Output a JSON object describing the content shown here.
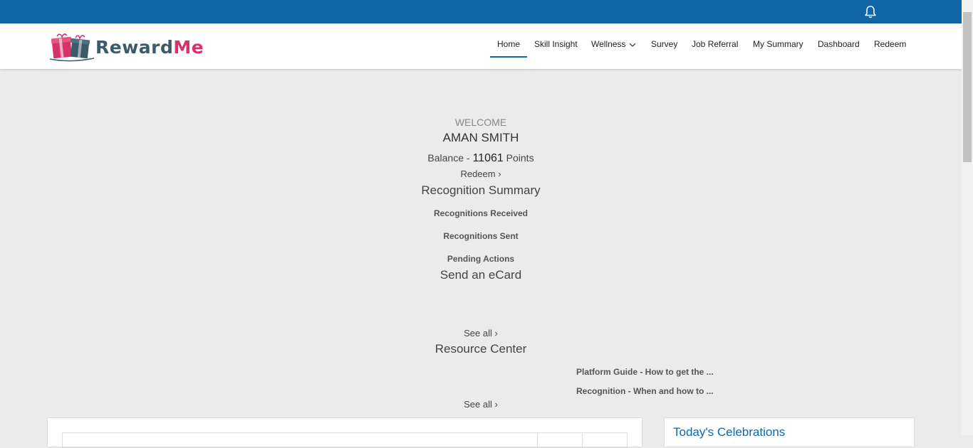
{
  "brand": {
    "part1": "Reward",
    "part2": "Me"
  },
  "nav": {
    "items": [
      "Home",
      "Skill Insight",
      "Wellness",
      "Survey",
      "Job Referral",
      "My Summary",
      "Dashboard",
      "Redeem"
    ]
  },
  "welcome": {
    "label": "WELCOME",
    "name": "AMAN SMITH",
    "balance_prefix": "Balance - ",
    "balance_value": "11061",
    "balance_suffix": " Points",
    "redeem_link": "Redeem ›"
  },
  "recognition": {
    "title": "Recognition Summary",
    "received": "Recognitions Received",
    "sent": "Recognitions Sent",
    "pending": "Pending Actions"
  },
  "ecard": {
    "title": "Send an eCard",
    "see_all": "See all ›"
  },
  "resources": {
    "title": "Resource Center",
    "items": [
      "Platform Guide - How to get the ...",
      "Recognition - When and how to ..."
    ],
    "see_all": "See all ›"
  },
  "celebrations": {
    "title": "Today's Celebrations"
  },
  "colors": {
    "primary": "#1166a8",
    "brand_pink": "#d6336c",
    "brand_slate": "#3d5a6b",
    "page_bg": "#ebebeb"
  },
  "icons": {
    "notification": "bell-icon",
    "logo": "gift-boxes-logo-icon",
    "dropdown": "chevron-down-icon"
  }
}
